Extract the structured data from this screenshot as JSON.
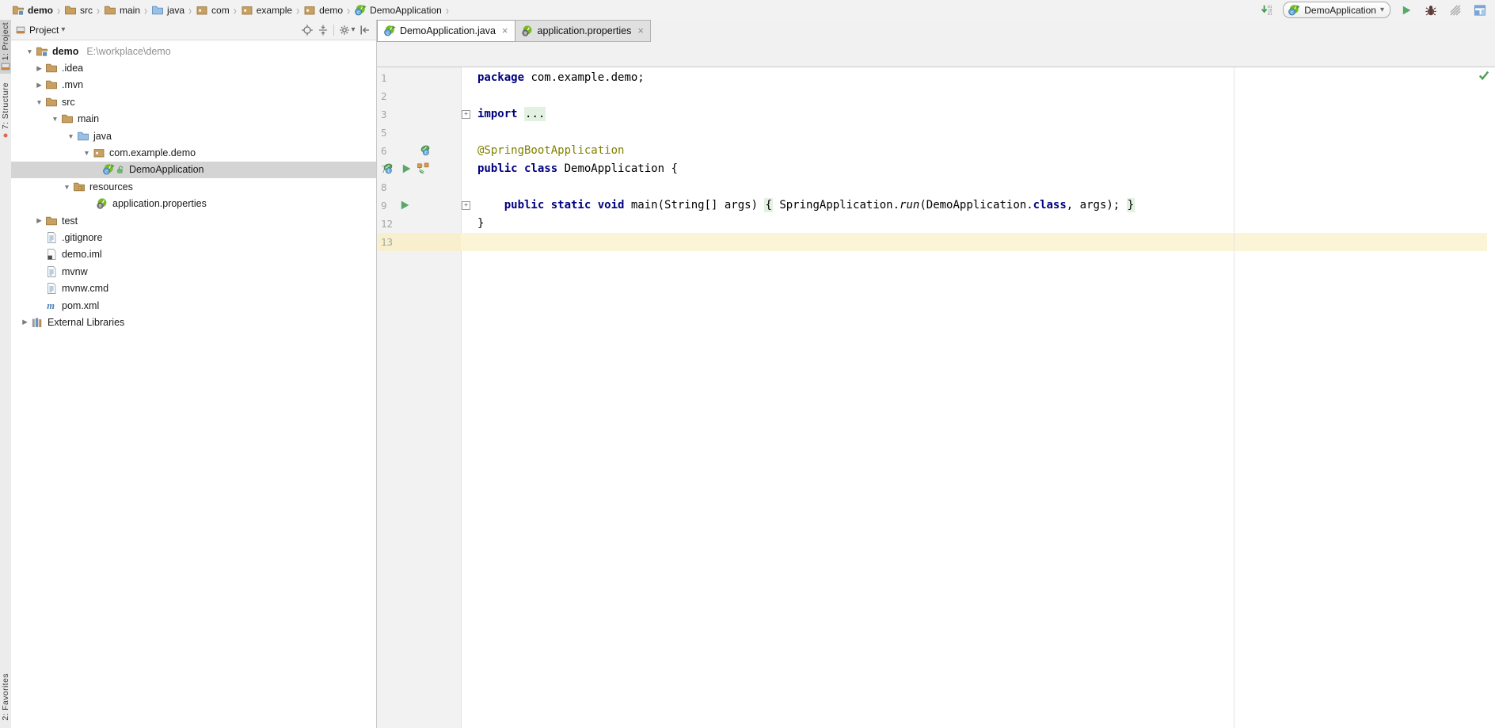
{
  "navbar": {
    "separator": "›",
    "items": [
      {
        "label": "demo",
        "icon": "project-folder",
        "bold": true
      },
      {
        "label": "src",
        "icon": "folder"
      },
      {
        "label": "main",
        "icon": "folder"
      },
      {
        "label": "java",
        "icon": "folder-blue"
      },
      {
        "label": "com",
        "icon": "package"
      },
      {
        "label": "example",
        "icon": "package"
      },
      {
        "label": "demo",
        "icon": "package"
      },
      {
        "label": "DemoApplication",
        "icon": "springboot-run"
      }
    ]
  },
  "toolbar": {
    "vcs_update_icon": "vcs-update",
    "run_config": {
      "label": "DemoApplication",
      "icon": "springboot-run",
      "arrow": "▾"
    },
    "buttons": [
      {
        "name": "run-button",
        "icon": "run-triangle"
      },
      {
        "name": "debug-button",
        "icon": "bug"
      },
      {
        "name": "coverage-button",
        "icon": "coverage"
      },
      {
        "name": "layout-button",
        "icon": "layout"
      }
    ]
  },
  "tool_strip": {
    "top": [
      {
        "label": "1: Project",
        "active": true,
        "icon": "tool-window"
      },
      {
        "label": "7: Structure",
        "active": false,
        "icon": "red-dot"
      }
    ],
    "bottom": [
      {
        "label": "2: Favorites",
        "active": false
      }
    ]
  },
  "project_panel": {
    "title": "Project",
    "title_icon": "tool-window",
    "title_arrow": "▾",
    "header_icons": [
      "aim",
      "scroll-source",
      "gear",
      "hide"
    ],
    "gear_arrow": "▾",
    "tree": [
      {
        "label": "demo",
        "bold": true,
        "sub": "E:\\workplace\\demo",
        "icon": "project-folder",
        "arrow": "down",
        "indent": 16,
        "selected": false
      },
      {
        "label": ".idea",
        "icon": "folder",
        "arrow": "right",
        "indent": 28,
        "selected": false
      },
      {
        "label": ".mvn",
        "icon": "folder",
        "arrow": "right",
        "indent": 28,
        "selected": false
      },
      {
        "label": "src",
        "icon": "folder",
        "arrow": "down",
        "indent": 28,
        "selected": false
      },
      {
        "label": "main",
        "icon": "folder",
        "arrow": "down",
        "indent": 48,
        "selected": false
      },
      {
        "label": "java",
        "icon": "folder-blue",
        "arrow": "down",
        "indent": 68,
        "selected": false
      },
      {
        "label": "com.example.demo",
        "icon": "package",
        "arrow": "down",
        "indent": 88,
        "selected": false
      },
      {
        "label": "DemoApplication",
        "icon": "springboot-run",
        "icon2": "lock",
        "arrow": "none",
        "indent": 115,
        "selected": true
      },
      {
        "label": "resources",
        "icon": "resources-folder",
        "arrow": "down",
        "indent": 63,
        "selected": false
      },
      {
        "label": "application.properties",
        "icon": "spring-properties",
        "arrow": "none",
        "indent": 107,
        "selected": false
      },
      {
        "label": "test",
        "icon": "folder",
        "arrow": "right",
        "indent": 28,
        "selected": false
      },
      {
        "label": ".gitignore",
        "icon": "text-file",
        "arrow": "none",
        "indent": 43,
        "selected": false
      },
      {
        "label": "demo.iml",
        "icon": "iml-file",
        "arrow": "none",
        "indent": 43,
        "selected": false
      },
      {
        "label": "mvnw",
        "icon": "text-file",
        "arrow": "none",
        "indent": 43,
        "selected": false
      },
      {
        "label": "mvnw.cmd",
        "icon": "text-file",
        "arrow": "none",
        "indent": 43,
        "selected": false
      },
      {
        "label": "pom.xml",
        "icon": "maven-file",
        "arrow": "none",
        "indent": 43,
        "selected": false
      },
      {
        "label": "External Libraries",
        "icon": "libraries",
        "arrow": "right",
        "indent": 10,
        "selected": false
      }
    ]
  },
  "tabs": [
    {
      "label": "DemoApplication.java",
      "icon": "springboot-run",
      "close": "×",
      "active": true
    },
    {
      "label": "application.properties",
      "icon": "spring-properties",
      "close": "×",
      "active": false
    }
  ],
  "editor": {
    "status_icon": "check",
    "lines": [
      {
        "num": "1",
        "tokens": [
          [
            "kw",
            "package"
          ],
          [
            "pl",
            " com.example.demo;"
          ]
        ]
      },
      {
        "num": "2",
        "tokens": []
      },
      {
        "num": "3",
        "fold": true,
        "tokens": [
          [
            "kw",
            "import"
          ],
          [
            "pl",
            " "
          ],
          [
            "fold",
            "..."
          ]
        ]
      },
      {
        "num": "5",
        "tokens": []
      },
      {
        "num": "6",
        "gutter": [
          {
            "icon": "spring-bean",
            "x": 53
          }
        ],
        "tokens": [
          [
            "ann",
            "@SpringBootApplication"
          ]
        ]
      },
      {
        "num": "7",
        "gutter": [
          {
            "icon": "spring-bean",
            "x": 6
          },
          {
            "icon": "run-triangle",
            "x": 29
          },
          {
            "icon": "beans-graph",
            "x": 50
          }
        ],
        "tokens": [
          [
            "kw",
            "public class"
          ],
          [
            "pl",
            " DemoApplication {"
          ]
        ]
      },
      {
        "num": "8",
        "tokens": []
      },
      {
        "num": "9",
        "fold": true,
        "gutter": [
          {
            "icon": "run-triangle",
            "x": 27
          }
        ],
        "tokens": [
          [
            "pl",
            "    "
          ],
          [
            "kw",
            "public static void"
          ],
          [
            "pl",
            " main(String[] args) "
          ],
          [
            "fold",
            "{"
          ],
          [
            "pl",
            " SpringApplication."
          ],
          [
            "it",
            "run"
          ],
          [
            "pl",
            "(DemoApplication."
          ],
          [
            "kw",
            "class"
          ],
          [
            "pl",
            ", args); "
          ],
          [
            "fold",
            "}"
          ]
        ]
      },
      {
        "num": "12",
        "tokens": [
          [
            "pl",
            "}"
          ]
        ]
      },
      {
        "num": "13",
        "caret": true,
        "tokens": []
      }
    ]
  },
  "colors": {
    "keyword": "#000080",
    "annotation": "#808000",
    "fold_background": "#e3f1e3",
    "caret_row": "#fbf4d7",
    "tree_selection": "#d4d4d4",
    "run_green": "#59A869"
  }
}
